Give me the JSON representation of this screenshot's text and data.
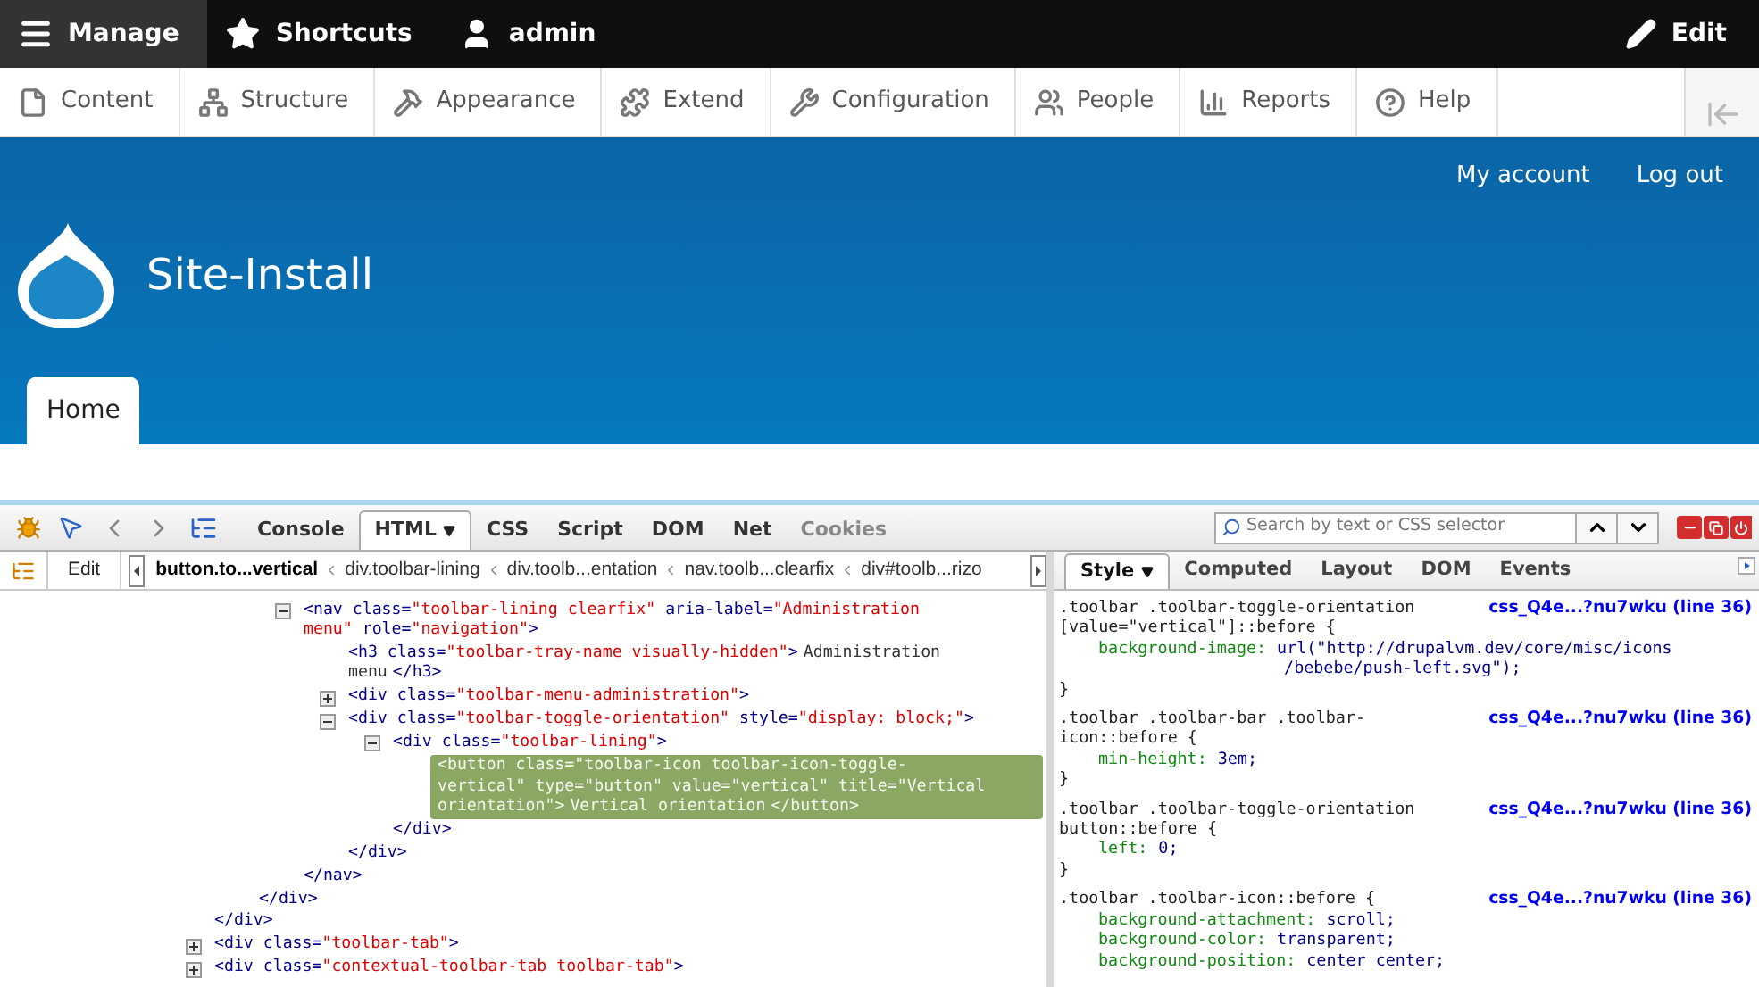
{
  "admin_toolbar": {
    "items": [
      {
        "label": "Manage",
        "selected": true
      },
      {
        "label": "Shortcuts",
        "selected": false
      },
      {
        "label": "admin",
        "selected": false
      }
    ],
    "edit": "Edit"
  },
  "admin_menu": {
    "items": [
      "Content",
      "Structure",
      "Appearance",
      "Extend",
      "Configuration",
      "People",
      "Reports",
      "Help"
    ]
  },
  "site_header": {
    "links": [
      "My account",
      "Log out"
    ],
    "site_name": "Site-Install",
    "tabs": [
      {
        "label": "Home",
        "selected": true
      }
    ]
  },
  "firebug": {
    "tabs": [
      {
        "label": "Console",
        "selected": false,
        "disabled": false
      },
      {
        "label": "HTML",
        "selected": true,
        "disabled": false
      },
      {
        "label": "CSS",
        "selected": false,
        "disabled": false
      },
      {
        "label": "Script",
        "selected": false,
        "disabled": false
      },
      {
        "label": "DOM",
        "selected": false,
        "disabled": false
      },
      {
        "label": "Net",
        "selected": false,
        "disabled": false
      },
      {
        "label": "Cookies",
        "selected": false,
        "disabled": true
      }
    ],
    "search": {
      "placeholder": "Search by text or CSS selector"
    },
    "edit_button": "Edit",
    "breadcrumbs": [
      {
        "label": "button.to...vertical",
        "selected": true
      },
      {
        "label": "div.toolbar-lining",
        "selected": false
      },
      {
        "label": "div.toolb...entation",
        "selected": false
      },
      {
        "label": "nav.toolb...clearfix",
        "selected": false
      },
      {
        "label": "div#toolb...rizo",
        "selected": false
      }
    ],
    "html_tree": [
      {
        "children": [
          {
            "children": [
              {
                "expanded": true,
                "selected": false,
                "open": [
                  {
                    "kind": "tag",
                    "text": "<nav"
                  },
                  {
                    "kind": "attr",
                    "text": " class="
                  },
                  {
                    "kind": "value",
                    "text": "\"toolbar-lining clearfix\""
                  },
                  {
                    "kind": "attr",
                    "text": " aria-label="
                  },
                  {
                    "kind": "value",
                    "text": "\"Administration menu\""
                  },
                  {
                    "kind": "attr",
                    "text": " role="
                  },
                  {
                    "kind": "value",
                    "text": "\"navigation\""
                  },
                  {
                    "kind": "tag",
                    "text": ">"
                  }
                ],
                "children": [
                  {
                    "selected": false,
                    "open": [
                      {
                        "kind": "tag",
                        "text": "<h3"
                      },
                      {
                        "kind": "attr",
                        "text": " class="
                      },
                      {
                        "kind": "value",
                        "text": "\"toolbar-tray-name visually-hidden\""
                      },
                      {
                        "kind": "tag",
                        "text": ">"
                      },
                      {
                        "kind": "text",
                        "text": "Administration menu"
                      },
                      {
                        "kind": "tag",
                        "text": "</h3>"
                      }
                    ]
                  },
                  {
                    "expanded": false,
                    "selected": false,
                    "open": [
                      {
                        "kind": "tag",
                        "text": "<div"
                      },
                      {
                        "kind": "attr",
                        "text": " class="
                      },
                      {
                        "kind": "value",
                        "text": "\"toolbar-menu-administration\""
                      },
                      {
                        "kind": "tag",
                        "text": ">"
                      }
                    ]
                  },
                  {
                    "expanded": true,
                    "selected": false,
                    "open": [
                      {
                        "kind": "tag",
                        "text": "<div"
                      },
                      {
                        "kind": "attr",
                        "text": " class="
                      },
                      {
                        "kind": "value",
                        "text": "\"toolbar-toggle-orientation\""
                      },
                      {
                        "kind": "attr",
                        "text": " style="
                      },
                      {
                        "kind": "value",
                        "text": "\"display: block;\""
                      },
                      {
                        "kind": "tag",
                        "text": ">"
                      }
                    ],
                    "children": [
                      {
                        "expanded": true,
                        "selected": false,
                        "open": [
                          {
                            "kind": "tag",
                            "text": "<div"
                          },
                          {
                            "kind": "attr",
                            "text": " class="
                          },
                          {
                            "kind": "value",
                            "text": "\"toolbar-lining\""
                          },
                          {
                            "kind": "tag",
                            "text": ">"
                          }
                        ],
                        "children": [
                          {
                            "selected": true,
                            "open": [
                              {
                                "kind": "tag",
                                "text": "<button"
                              },
                              {
                                "kind": "attr",
                                "text": " class="
                              },
                              {
                                "kind": "value",
                                "text": "\"toolbar-icon toolbar-icon-toggle-vertical\""
                              },
                              {
                                "kind": "attr",
                                "text": " type="
                              },
                              {
                                "kind": "value",
                                "text": "\"button\""
                              },
                              {
                                "kind": "attr",
                                "text": " value="
                              },
                              {
                                "kind": "value",
                                "text": "\"vertical\""
                              },
                              {
                                "kind": "attr",
                                "text": " title="
                              },
                              {
                                "kind": "value",
                                "text": "\"Vertical orientation\""
                              },
                              {
                                "kind": "tag",
                                "text": ">"
                              },
                              {
                                "kind": "text",
                                "text": "Vertical orientation"
                              },
                              {
                                "kind": "tag",
                                "text": "</button>"
                              }
                            ]
                          }
                        ],
                        "close": "</div>"
                      }
                    ],
                    "close": "</div>"
                  }
                ],
                "close": "</nav>"
              }
            ],
            "close": "</div>"
          }
        ],
        "close": "</div>"
      },
      {
        "expanded": false,
        "selected": false,
        "open": [
          {
            "kind": "tag",
            "text": "<div"
          },
          {
            "kind": "attr",
            "text": " class="
          },
          {
            "kind": "value",
            "text": "\"toolbar-tab\""
          },
          {
            "kind": "tag",
            "text": ">"
          }
        ]
      },
      {
        "expanded": false,
        "selected": false,
        "open": [
          {
            "kind": "tag",
            "text": "<div"
          },
          {
            "kind": "attr",
            "text": " class="
          },
          {
            "kind": "value",
            "text": "\"contextual-toolbar-tab toolbar-tab\""
          },
          {
            "kind": "tag",
            "text": ">"
          }
        ]
      }
    ],
    "side_tabs": [
      {
        "label": "Style",
        "selected": true
      },
      {
        "label": "Computed",
        "selected": false
      },
      {
        "label": "Layout",
        "selected": false
      },
      {
        "label": "DOM",
        "selected": false
      },
      {
        "label": "Events",
        "selected": false
      }
    ],
    "css_rules": [
      {
        "selector": ".toolbar .toolbar-toggle-orientation [value=\"vertical\"]::before {",
        "source": "css_Q4e...?nu7wku (line 36)",
        "declarations": [
          {
            "property": "background-image:",
            "value_lines": [
              "url(\"http://drupalvm.dev/core/misc/icons",
              "/bebebe/push-left.svg\");"
            ]
          }
        ],
        "close": "}"
      },
      {
        "selector": ".toolbar .toolbar-bar .toolbar-icon::before {",
        "source": "css_Q4e...?nu7wku (line 36)",
        "declarations": [
          {
            "property": "min-height:",
            "value_lines": [
              "3em;"
            ]
          }
        ],
        "close": "}"
      },
      {
        "selector": ".toolbar .toolbar-toggle-orientation button::before {",
        "source": "css_Q4e...?nu7wku (line 36)",
        "declarations": [
          {
            "property": "left:",
            "value_lines": [
              "0;"
            ]
          }
        ],
        "close": "}"
      },
      {
        "selector": ".toolbar .toolbar-icon::before {",
        "source": "css_Q4e...?nu7wku (line 36)",
        "declarations": [
          {
            "property": "background-attachment:",
            "value_lines": [
              "scroll;"
            ]
          },
          {
            "property": "background-color:",
            "value_lines": [
              "transparent;"
            ]
          },
          {
            "property": "background-position:",
            "value_lines": [
              "center center;"
            ]
          }
        ]
      }
    ]
  }
}
